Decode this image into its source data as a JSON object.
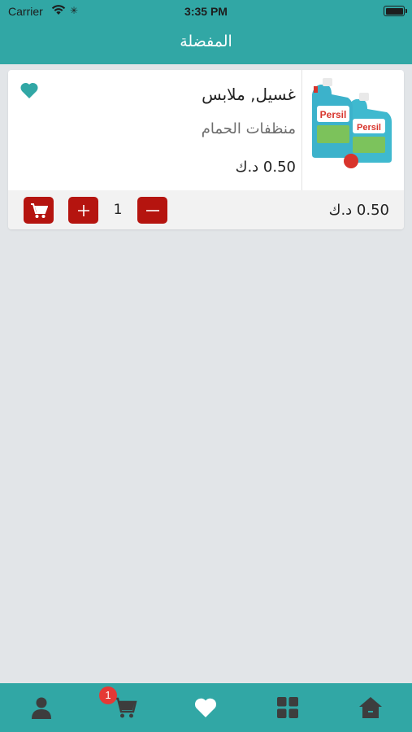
{
  "status_bar": {
    "carrier": "Carrier",
    "time": "3:35 PM"
  },
  "header": {
    "title": "المفضلة"
  },
  "favorites": [
    {
      "name": "غسيل, ملابس",
      "category": "منظفات الحمام",
      "price": "0.50 د.ك",
      "quantity": "1",
      "total": "0.50 د.ك",
      "image": "persil-detergent-bottles"
    }
  ],
  "tab_bar": {
    "cart_badge": "1",
    "items": [
      "profile-icon",
      "cart-icon",
      "heart-icon",
      "grid-icon",
      "home-icon"
    ]
  },
  "colors": {
    "accent": "#31a7a5",
    "button_red": "#b5140f",
    "background": "#e2e5e8",
    "badge": "#e53935"
  }
}
